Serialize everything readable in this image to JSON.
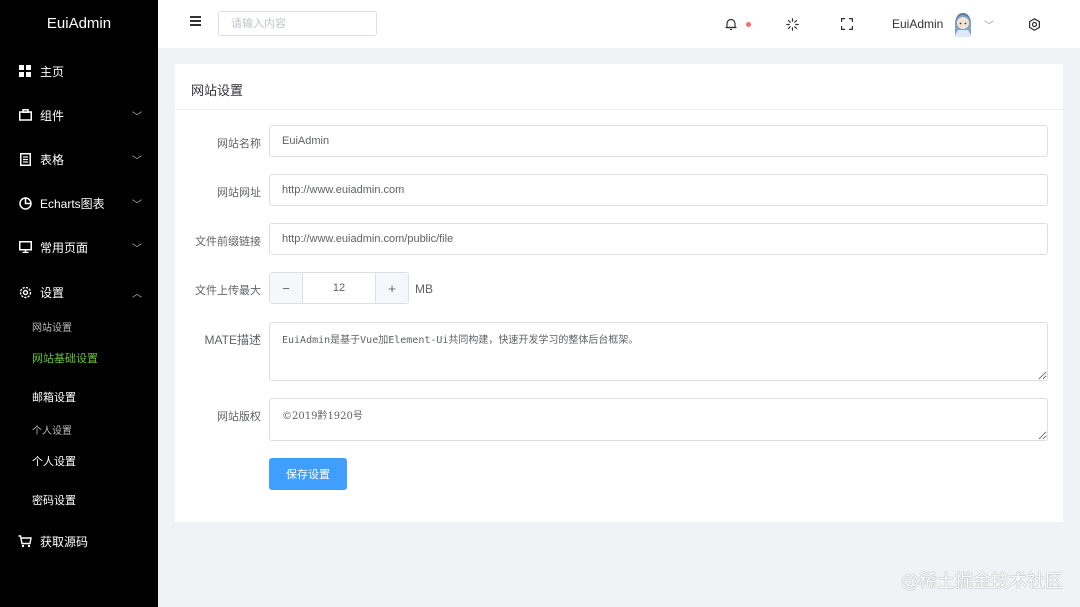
{
  "brand": "EuiAdmin",
  "sidebar": {
    "items": [
      {
        "label": "主页",
        "icon": "grid-icon"
      },
      {
        "label": "组件",
        "icon": "briefcase-icon"
      },
      {
        "label": "表格",
        "icon": "document-icon"
      },
      {
        "label": "Echarts图表",
        "icon": "pie-chart-icon"
      },
      {
        "label": "常用页面",
        "icon": "monitor-icon"
      },
      {
        "label": "设置",
        "icon": "gear-icon"
      },
      {
        "label": "获取源码",
        "icon": "cart-icon"
      }
    ],
    "sub_items": [
      "网站设置",
      "网站基础设置",
      "邮箱设置",
      "个人设置",
      "个人设置",
      "密码设置"
    ]
  },
  "header": {
    "search_placeholder": "请输入内容",
    "user_name": "EuiAdmin",
    "icons": [
      "menu-icon",
      "bell-icon",
      "loading-icon",
      "fullscreen-icon",
      "settings-icon"
    ],
    "notification_dot_color": "#f56c6c"
  },
  "card": {
    "title": "网站设置",
    "fields": [
      {
        "label": "网站名称",
        "value": "EuiAdmin"
      },
      {
        "label": "网站网址",
        "value": "http://www.euiadmin.com"
      },
      {
        "label": "文件前缀链接",
        "value": "http://www.euiadmin.com/public/file"
      },
      {
        "label": "文件上传最大",
        "value": "12",
        "unit": "MB"
      },
      {
        "label": "MATE描述",
        "value": "EuiAdmin是基于Vue加Element-Ui共同构建，快速开发学习的整体后台框架。"
      },
      {
        "label": "网站版权",
        "value": "©2019黔1920号"
      }
    ],
    "save_label": "保存设置"
  },
  "colors": {
    "accent": "#409eff",
    "active_sub": "#67c23a",
    "sidebar_bg": "#000000"
  },
  "watermark": "@稀土掘金技术社区"
}
